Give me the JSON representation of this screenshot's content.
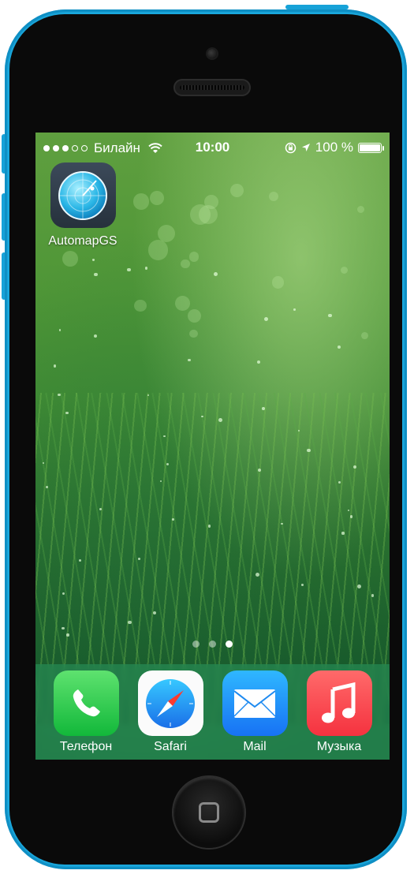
{
  "status_bar": {
    "carrier": "Билайн",
    "time": "10:00",
    "battery": "100 %",
    "signal_bars": 5,
    "signal_filled": 3
  },
  "home_screen": {
    "apps": [
      {
        "label": "AutomapGS",
        "icon": "radar-globe-icon"
      }
    ],
    "page_count": 3,
    "current_page": 3
  },
  "dock": {
    "items": [
      {
        "label": "Телефон",
        "icon": "phone-icon",
        "color": "#12b83a"
      },
      {
        "label": "Safari",
        "icon": "compass-icon",
        "color": "#1a8cff"
      },
      {
        "label": "Mail",
        "icon": "envelope-icon",
        "color": "#1772f4"
      },
      {
        "label": "Музыка",
        "icon": "music-note-icon",
        "color": "#f5323f"
      }
    ]
  },
  "device": {
    "color": "#1bb0e8"
  }
}
